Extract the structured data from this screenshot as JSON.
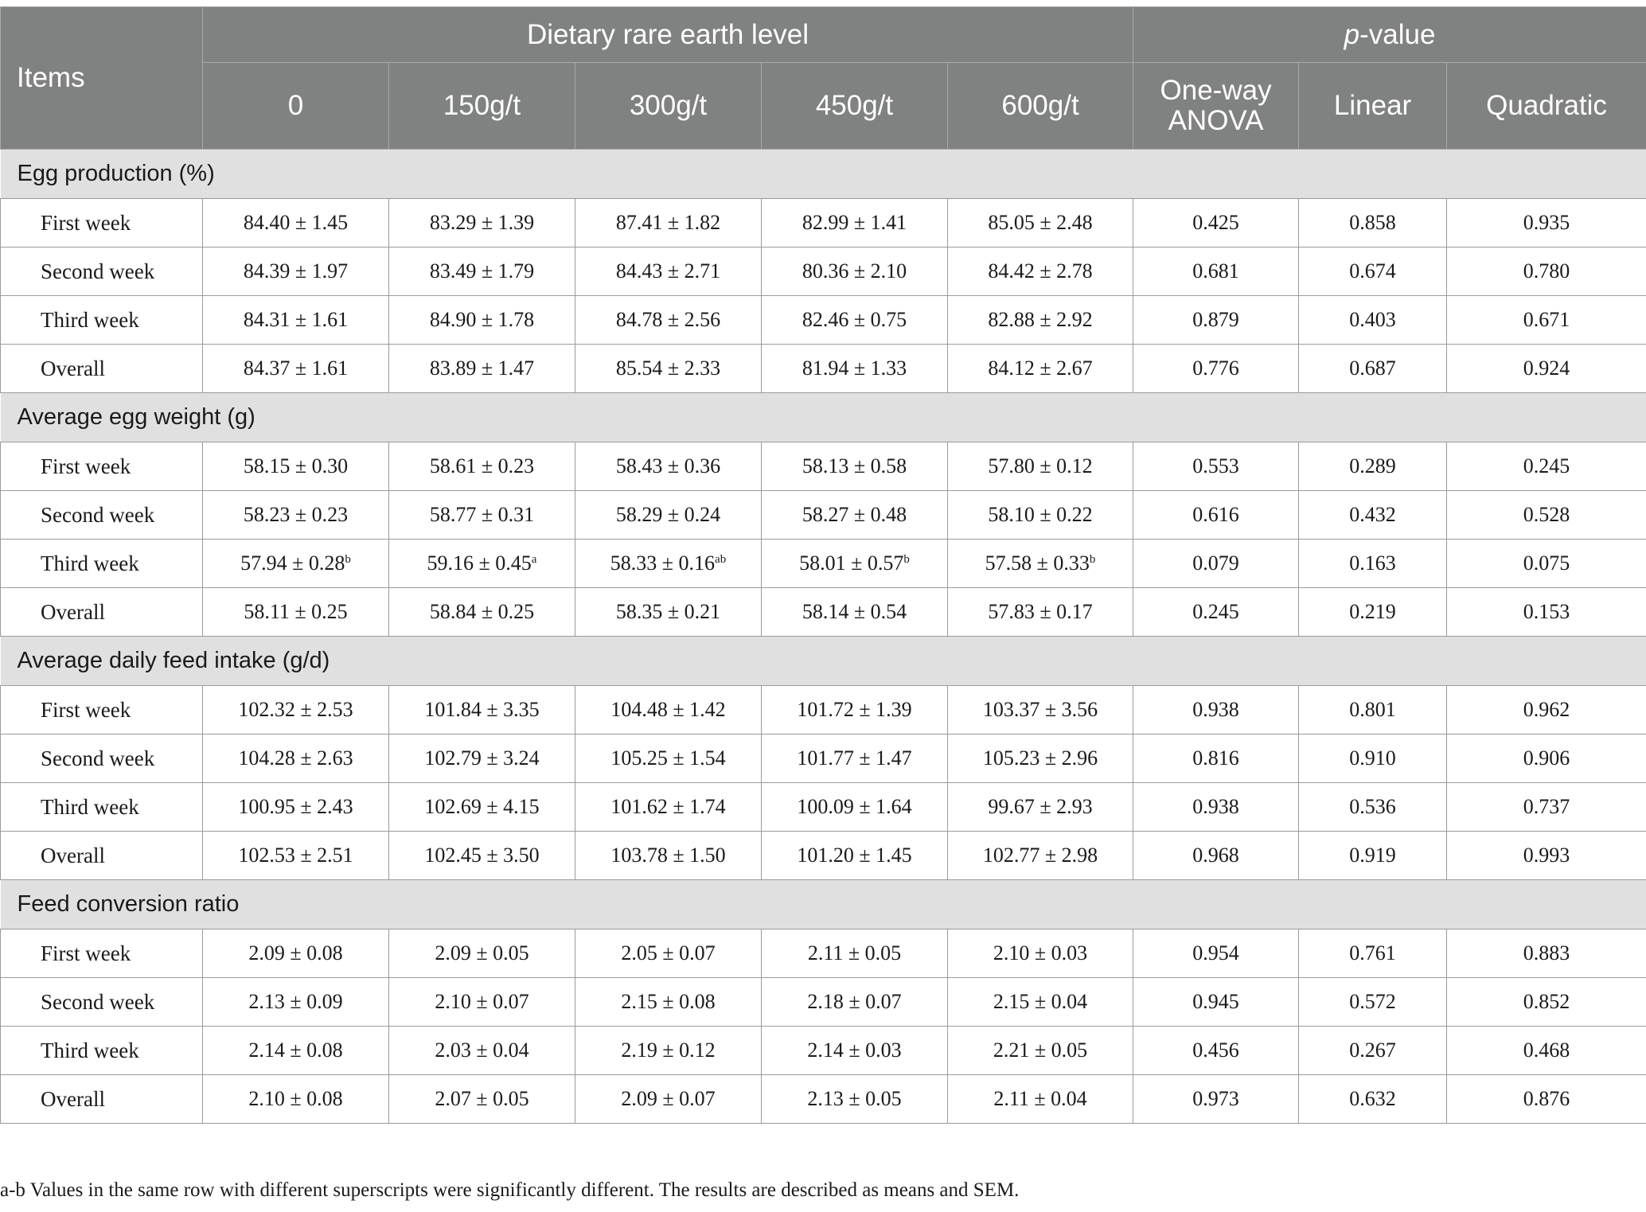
{
  "header": {
    "items_label": "Items",
    "group_label": "Dietary rare earth level",
    "pvalue_italic": "p",
    "pvalue_rest": "-value",
    "levels": [
      "0",
      "150g/t",
      "300g/t",
      "450g/t",
      "600g/t"
    ],
    "tests": [
      "One-way ANOVA",
      "Linear",
      "Quadratic"
    ]
  },
  "sections": [
    {
      "title": "Egg production (%)",
      "rows": [
        {
          "label": "First week",
          "values": [
            {
              "v": "84.40 ± 1.45",
              "sup": ""
            },
            {
              "v": "83.29 ± 1.39",
              "sup": ""
            },
            {
              "v": "87.41 ± 1.82",
              "sup": ""
            },
            {
              "v": "82.99 ± 1.41",
              "sup": ""
            },
            {
              "v": "85.05 ± 2.48",
              "sup": ""
            }
          ],
          "p": [
            "0.425",
            "0.858",
            "0.935"
          ]
        },
        {
          "label": "Second week",
          "values": [
            {
              "v": "84.39 ± 1.97",
              "sup": ""
            },
            {
              "v": "83.49 ± 1.79",
              "sup": ""
            },
            {
              "v": "84.43 ± 2.71",
              "sup": ""
            },
            {
              "v": "80.36 ± 2.10",
              "sup": ""
            },
            {
              "v": "84.42 ± 2.78",
              "sup": ""
            }
          ],
          "p": [
            "0.681",
            "0.674",
            "0.780"
          ]
        },
        {
          "label": "Third week",
          "values": [
            {
              "v": "84.31 ± 1.61",
              "sup": ""
            },
            {
              "v": "84.90 ± 1.78",
              "sup": ""
            },
            {
              "v": "84.78 ± 2.56",
              "sup": ""
            },
            {
              "v": "82.46 ± 0.75",
              "sup": ""
            },
            {
              "v": "82.88 ± 2.92",
              "sup": ""
            }
          ],
          "p": [
            "0.879",
            "0.403",
            "0.671"
          ]
        },
        {
          "label": "Overall",
          "values": [
            {
              "v": "84.37 ± 1.61",
              "sup": ""
            },
            {
              "v": "83.89 ± 1.47",
              "sup": ""
            },
            {
              "v": "85.54 ± 2.33",
              "sup": ""
            },
            {
              "v": "81.94 ± 1.33",
              "sup": ""
            },
            {
              "v": "84.12 ± 2.67",
              "sup": ""
            }
          ],
          "p": [
            "0.776",
            "0.687",
            "0.924"
          ]
        }
      ]
    },
    {
      "title": "Average egg weight (g)",
      "rows": [
        {
          "label": "First week",
          "values": [
            {
              "v": "58.15 ± 0.30",
              "sup": ""
            },
            {
              "v": "58.61 ± 0.23",
              "sup": ""
            },
            {
              "v": "58.43 ± 0.36",
              "sup": ""
            },
            {
              "v": "58.13 ± 0.58",
              "sup": ""
            },
            {
              "v": "57.80 ± 0.12",
              "sup": ""
            }
          ],
          "p": [
            "0.553",
            "0.289",
            "0.245"
          ]
        },
        {
          "label": "Second week",
          "values": [
            {
              "v": "58.23 ± 0.23",
              "sup": ""
            },
            {
              "v": "58.77 ± 0.31",
              "sup": ""
            },
            {
              "v": "58.29 ± 0.24",
              "sup": ""
            },
            {
              "v": "58.27 ± 0.48",
              "sup": ""
            },
            {
              "v": "58.10 ± 0.22",
              "sup": ""
            }
          ],
          "p": [
            "0.616",
            "0.432",
            "0.528"
          ]
        },
        {
          "label": "Third week",
          "values": [
            {
              "v": "57.94 ± 0.28",
              "sup": "b"
            },
            {
              "v": "59.16 ± 0.45",
              "sup": "a"
            },
            {
              "v": "58.33 ± 0.16",
              "sup": "ab"
            },
            {
              "v": "58.01 ± 0.57",
              "sup": "b"
            },
            {
              "v": "57.58 ± 0.33",
              "sup": "b"
            }
          ],
          "p": [
            "0.079",
            "0.163",
            "0.075"
          ]
        },
        {
          "label": "Overall",
          "values": [
            {
              "v": "58.11 ± 0.25",
              "sup": ""
            },
            {
              "v": "58.84 ± 0.25",
              "sup": ""
            },
            {
              "v": "58.35 ± 0.21",
              "sup": ""
            },
            {
              "v": "58.14 ± 0.54",
              "sup": ""
            },
            {
              "v": "57.83 ± 0.17",
              "sup": ""
            }
          ],
          "p": [
            "0.245",
            "0.219",
            "0.153"
          ]
        }
      ]
    },
    {
      "title": "Average daily feed intake (g/d)",
      "rows": [
        {
          "label": "First week",
          "values": [
            {
              "v": "102.32 ± 2.53",
              "sup": ""
            },
            {
              "v": "101.84 ± 3.35",
              "sup": ""
            },
            {
              "v": "104.48 ± 1.42",
              "sup": ""
            },
            {
              "v": "101.72 ± 1.39",
              "sup": ""
            },
            {
              "v": "103.37 ± 3.56",
              "sup": ""
            }
          ],
          "p": [
            "0.938",
            "0.801",
            "0.962"
          ]
        },
        {
          "label": "Second week",
          "values": [
            {
              "v": "104.28 ± 2.63",
              "sup": ""
            },
            {
              "v": "102.79 ± 3.24",
              "sup": ""
            },
            {
              "v": "105.25 ± 1.54",
              "sup": ""
            },
            {
              "v": "101.77 ± 1.47",
              "sup": ""
            },
            {
              "v": "105.23 ± 2.96",
              "sup": ""
            }
          ],
          "p": [
            "0.816",
            "0.910",
            "0.906"
          ]
        },
        {
          "label": "Third week",
          "values": [
            {
              "v": "100.95 ± 2.43",
              "sup": ""
            },
            {
              "v": "102.69 ± 4.15",
              "sup": ""
            },
            {
              "v": "101.62 ± 1.74",
              "sup": ""
            },
            {
              "v": "100.09 ± 1.64",
              "sup": ""
            },
            {
              "v": "99.67 ± 2.93",
              "sup": ""
            }
          ],
          "p": [
            "0.938",
            "0.536",
            "0.737"
          ]
        },
        {
          "label": "Overall",
          "values": [
            {
              "v": "102.53 ± 2.51",
              "sup": ""
            },
            {
              "v": "102.45 ± 3.50",
              "sup": ""
            },
            {
              "v": "103.78 ± 1.50",
              "sup": ""
            },
            {
              "v": "101.20 ± 1.45",
              "sup": ""
            },
            {
              "v": "102.77 ± 2.98",
              "sup": ""
            }
          ],
          "p": [
            "0.968",
            "0.919",
            "0.993"
          ]
        }
      ]
    },
    {
      "title": "Feed conversion ratio",
      "rows": [
        {
          "label": "First week",
          "values": [
            {
              "v": "2.09 ± 0.08",
              "sup": ""
            },
            {
              "v": "2.09 ± 0.05",
              "sup": ""
            },
            {
              "v": "2.05 ± 0.07",
              "sup": ""
            },
            {
              "v": "2.11 ± 0.05",
              "sup": ""
            },
            {
              "v": "2.10 ± 0.03",
              "sup": ""
            }
          ],
          "p": [
            "0.954",
            "0.761",
            "0.883"
          ]
        },
        {
          "label": "Second week",
          "values": [
            {
              "v": "2.13 ± 0.09",
              "sup": ""
            },
            {
              "v": "2.10 ± 0.07",
              "sup": ""
            },
            {
              "v": "2.15 ± 0.08",
              "sup": ""
            },
            {
              "v": "2.18 ± 0.07",
              "sup": ""
            },
            {
              "v": "2.15 ± 0.04",
              "sup": ""
            }
          ],
          "p": [
            "0.945",
            "0.572",
            "0.852"
          ]
        },
        {
          "label": "Third week",
          "values": [
            {
              "v": "2.14 ± 0.08",
              "sup": ""
            },
            {
              "v": "2.03 ± 0.04",
              "sup": ""
            },
            {
              "v": "2.19 ± 0.12",
              "sup": ""
            },
            {
              "v": "2.14 ± 0.03",
              "sup": ""
            },
            {
              "v": "2.21 ± 0.05",
              "sup": ""
            }
          ],
          "p": [
            "0.456",
            "0.267",
            "0.468"
          ]
        },
        {
          "label": "Overall",
          "values": [
            {
              "v": "2.10 ± 0.08",
              "sup": ""
            },
            {
              "v": "2.07 ± 0.05",
              "sup": ""
            },
            {
              "v": "2.09 ± 0.07",
              "sup": ""
            },
            {
              "v": "2.13 ± 0.05",
              "sup": ""
            },
            {
              "v": "2.11 ± 0.04",
              "sup": ""
            }
          ],
          "p": [
            "0.973",
            "0.632",
            "0.876"
          ]
        }
      ]
    }
  ],
  "footnote": "a-b Values in the same row with different superscripts were significantly different. The results are described as means and SEM."
}
